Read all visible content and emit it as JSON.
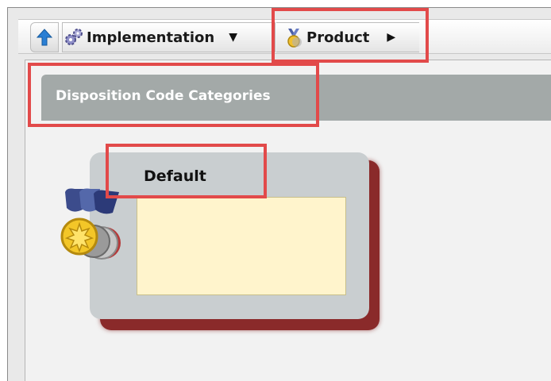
{
  "breadcrumb": {
    "items": [
      {
        "label": "Implementation",
        "icon": "gears-icon",
        "has_dropdown": true
      },
      {
        "label": "Product",
        "icon": "medal-icon",
        "has_arrow": true
      }
    ],
    "up_icon": "up-arrow-icon"
  },
  "section": {
    "title": "Disposition Code Categories"
  },
  "card": {
    "title": "Default",
    "icon": "medal-icon"
  },
  "colors": {
    "highlight": "#e24a4a",
    "header_bg": "#a3a9a8",
    "card_bg": "#c9ced0",
    "card_body_bg": "#fff4cc",
    "card_shadow": "#8a2a2a"
  }
}
